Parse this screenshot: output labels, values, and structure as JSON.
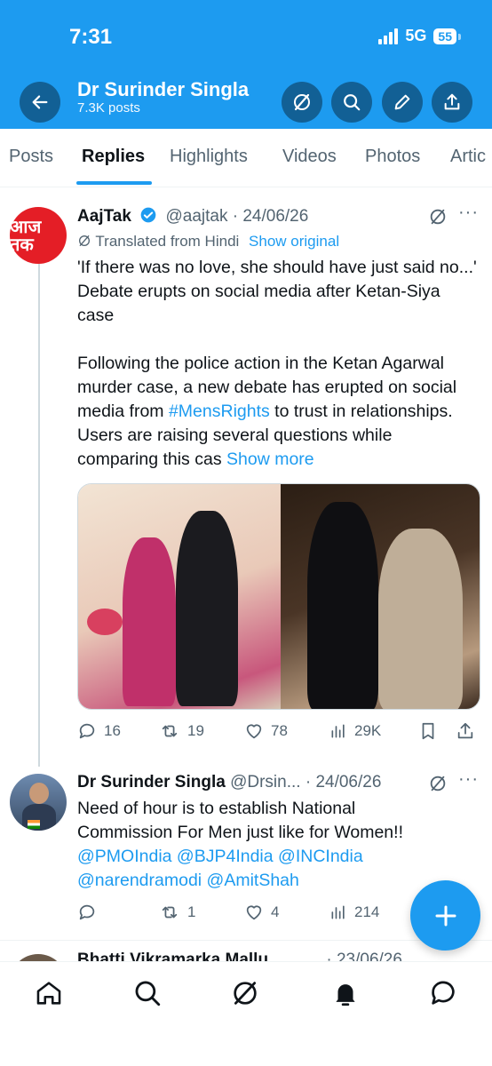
{
  "status": {
    "time": "7:31",
    "network": "5G",
    "battery": "55"
  },
  "header": {
    "name": "Dr Surinder Singla",
    "posts": "7.3K posts"
  },
  "tabs": [
    "Posts",
    "Replies",
    "Highlights",
    "Videos",
    "Photos",
    "Artic"
  ],
  "tweet1": {
    "avatar_text": "आज तक",
    "name": "AajTak",
    "handle": "@aajtak",
    "date": "· 24/06/26",
    "translated": "Translated from Hindi",
    "show_original": "Show original",
    "line1": "'If there was no love, she should have just said no...' Debate erupts on social media after Ketan-Siya case",
    "line2_a": "Following the police action in the Ketan Agarwal murder case, a new debate has erupted on social media from ",
    "hashtag": "#MensRights",
    "line2_b": " to trust in relationships. Users are raising several questions while comparing this cas ",
    "show_more": "Show more",
    "replies": "16",
    "reposts": "19",
    "likes": "78",
    "views": "29K"
  },
  "tweet2": {
    "name": "Dr Surinder Singla",
    "handle": "@Drsin...",
    "date": "· 24/06/26",
    "text": "Need of hour is to establish National Commission For Men just like for Women!!",
    "mentions": "@PMOIndia @BJP4India @INCIndia @narendramodi @AmitShah",
    "replies": "",
    "reposts": "1",
    "likes": "4",
    "views": "214"
  },
  "peek": {
    "text": "Bhatti Vikramarka Mallu",
    "date": "· 23/06/26"
  },
  "colors": {
    "accent": "#1d9bf0",
    "aajtak": "#e41e26"
  }
}
